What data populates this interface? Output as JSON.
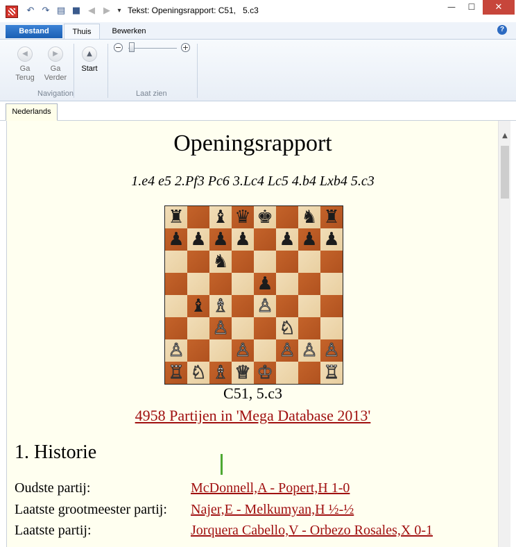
{
  "window": {
    "title": "Tekst: Openingsrapport: C51,   5.c3",
    "controls": {
      "minimize": "—",
      "maximize": "☐",
      "close": "✕"
    }
  },
  "quick_access": [
    "undo-icon",
    "redo-icon",
    "print-icon",
    "save-icon",
    "back-icon",
    "forward-icon",
    "customize-icon"
  ],
  "ribbon": {
    "file_tab": "Bestand",
    "tabs": [
      "Thuis",
      "Bewerken"
    ],
    "active_tab": "Thuis",
    "buttons": {
      "back": {
        "line1": "Ga",
        "line2": "Terug"
      },
      "forward": {
        "line1": "Ga",
        "line2": "Verder"
      },
      "start": "Start"
    },
    "groups": {
      "navigation": "Navigation",
      "view": "Laat zien"
    },
    "zoom": {
      "minus": "−",
      "plus": "+"
    }
  },
  "document_tab": "Nederlands",
  "report": {
    "title": "Openingsrapport",
    "moves": "1.e4 e5 2.Pf3 Pc6 3.Lc4 Lc5 4.b4 Lxb4 5.c3",
    "eco": "C51, 5.c3",
    "database_link": "4958 Partijen in 'Mega Database 2013'",
    "section_title": "1. Historie",
    "rows": [
      {
        "label": "Oudste partij:",
        "value": "McDonnell,A - Popert,H 1-0"
      },
      {
        "label": "Laatste grootmeester partij:",
        "value": "Najer,E - Melkumyan,H ½-½"
      },
      {
        "label": "Laatste partij:",
        "value": "Jorquera Cabello,V - Orbezo Rosales,X 0-1"
      }
    ]
  },
  "board": {
    "ranks": [
      [
        "♜",
        "",
        "♝",
        "♛",
        "♚",
        "",
        "♞",
        "♜"
      ],
      [
        "♟",
        "♟",
        "♟",
        "♟",
        "",
        "♟",
        "♟",
        "♟"
      ],
      [
        "",
        "",
        "♞",
        "",
        "",
        "",
        "",
        ""
      ],
      [
        "",
        "",
        "",
        "",
        "♟",
        "",
        "",
        ""
      ],
      [
        "",
        "♝",
        "♗",
        "",
        "♙",
        "",
        "",
        ""
      ],
      [
        "",
        "",
        "♙",
        "",
        "",
        "♘",
        "",
        ""
      ],
      [
        "♙",
        "",
        "",
        "♙",
        "",
        "♙",
        "♙",
        "♙"
      ],
      [
        "♖",
        "♘",
        "♗",
        "♕",
        "♔",
        "",
        "",
        "♖"
      ]
    ],
    "last_move_arrow": "c2-c3"
  }
}
